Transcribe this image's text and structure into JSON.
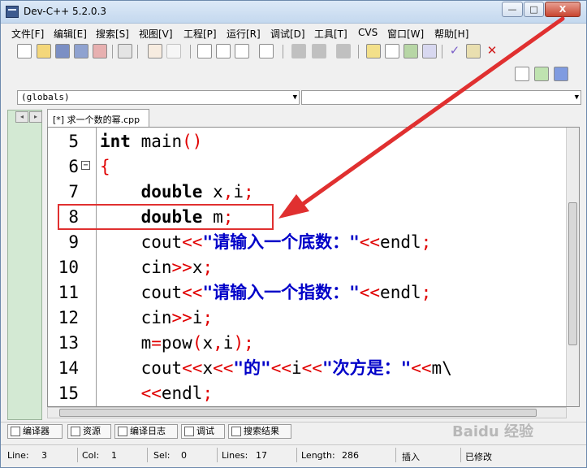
{
  "window": {
    "title": "Dev-C++ 5.2.0.3",
    "buttons": {
      "minimize": "—",
      "maximize": "□",
      "close": "X"
    }
  },
  "menu": [
    "文件[F]",
    "编辑[E]",
    "搜索[S]",
    "视图[V]",
    "工程[P]",
    "运行[R]",
    "调试[D]",
    "工具[T]",
    "CVS",
    "窗口[W]",
    "帮助[H]"
  ],
  "toolbar": {
    "icons": [
      "new-file-icon",
      "open-icon",
      "save-icon",
      "save-all-icon",
      "close-file-icon",
      "print-icon",
      "undo-icon",
      "redo-icon",
      "find-icon",
      "replace-icon",
      "find-next-icon",
      "goto-line-icon",
      "indent-icon",
      "unindent-icon",
      "comment-icon",
      "compile-icon",
      "run-icon",
      "compile-run-icon",
      "rebuild-icon",
      "check-icon",
      "chart-icon",
      "stop-icon"
    ]
  },
  "combos": {
    "scope": "(globals)",
    "member": ""
  },
  "editor": {
    "tab_label": "[*] 求一个数的幂.cpp",
    "lines": [
      {
        "n": "5",
        "tokens": [
          [
            "kw",
            "int"
          ],
          [
            "t",
            " main"
          ],
          [
            "op",
            "()"
          ]
        ]
      },
      {
        "n": "6",
        "fold": "⊟",
        "tokens": [
          [
            "op",
            "{"
          ]
        ]
      },
      {
        "n": "7",
        "tokens": [
          [
            "t",
            "    "
          ],
          [
            "kw",
            "double"
          ],
          [
            "t",
            " x"
          ],
          [
            "op",
            ","
          ],
          [
            "t",
            "i"
          ],
          [
            "op",
            ";"
          ]
        ]
      },
      {
        "n": "8",
        "tokens": [
          [
            "t",
            "    "
          ],
          [
            "kw",
            "double"
          ],
          [
            "t",
            " m"
          ],
          [
            "op",
            ";"
          ]
        ]
      },
      {
        "n": "9",
        "tokens": [
          [
            "t",
            "    cout"
          ],
          [
            "op",
            "<<"
          ],
          [
            "str",
            "\"请输入一个底数：\""
          ],
          [
            "op",
            "<<"
          ],
          [
            "t",
            "endl"
          ],
          [
            "op",
            ";"
          ]
        ]
      },
      {
        "n": "10",
        "tokens": [
          [
            "t",
            "    cin"
          ],
          [
            "op",
            ">>"
          ],
          [
            "t",
            "x"
          ],
          [
            "op",
            ";"
          ]
        ]
      },
      {
        "n": "11",
        "tokens": [
          [
            "t",
            "    cout"
          ],
          [
            "op",
            "<<"
          ],
          [
            "str",
            "\"请输入一个指数：\""
          ],
          [
            "op",
            "<<"
          ],
          [
            "t",
            "endl"
          ],
          [
            "op",
            ";"
          ]
        ]
      },
      {
        "n": "12",
        "tokens": [
          [
            "t",
            "    cin"
          ],
          [
            "op",
            ">>"
          ],
          [
            "t",
            "i"
          ],
          [
            "op",
            ";"
          ]
        ]
      },
      {
        "n": "13",
        "tokens": [
          [
            "t",
            "    m"
          ],
          [
            "op",
            "="
          ],
          [
            "t",
            "pow"
          ],
          [
            "op",
            "("
          ],
          [
            "t",
            "x"
          ],
          [
            "op",
            ","
          ],
          [
            "t",
            "i"
          ],
          [
            "op",
            ");"
          ]
        ]
      },
      {
        "n": "14",
        "tokens": [
          [
            "t",
            "    cout"
          ],
          [
            "op",
            "<<"
          ],
          [
            "t",
            "x"
          ],
          [
            "op",
            "<<"
          ],
          [
            "str",
            "\"的\""
          ],
          [
            "op",
            "<<"
          ],
          [
            "t",
            "i"
          ],
          [
            "op",
            "<<"
          ],
          [
            "str",
            "\"次方是：\""
          ],
          [
            "op",
            "<<"
          ],
          [
            "t",
            "m\\"
          ]
        ]
      },
      {
        "n": "15",
        "tokens": [
          [
            "t",
            "    "
          ],
          [
            "op",
            "<<"
          ],
          [
            "t",
            "endl"
          ],
          [
            "op",
            ";"
          ]
        ]
      }
    ]
  },
  "bottom_tabs": [
    "编译器",
    "资源",
    "编译日志",
    "调试",
    "搜索结果"
  ],
  "status": {
    "line": "Line:",
    "line_val": "3",
    "col": "Col:",
    "col_val": "1",
    "sel": "Sel:",
    "sel_val": "0",
    "lines": "Lines:",
    "lines_val": "17",
    "length": "Length:",
    "length_val": "286",
    "mode": "插入",
    "modified": "已修改"
  },
  "watermark": "Baidu 经验",
  "colors": {
    "annotation": "#e03030",
    "keyword": "#000000",
    "operator": "#e00000",
    "string": "#0000c8",
    "gutter_panel": "#d3e9d3"
  }
}
